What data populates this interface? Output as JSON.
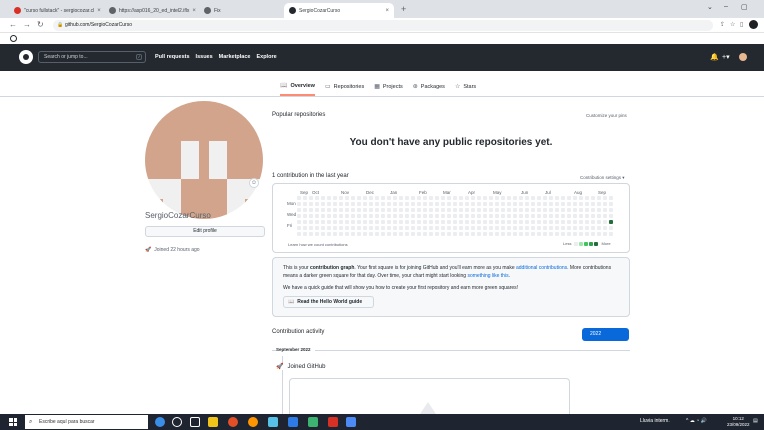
{
  "browser": {
    "tabs": [
      {
        "title": "\"curso fullstack\" - sergiocozar.cl",
        "favicon_color": "#d93025"
      },
      {
        "title": "https://asp016_20_ed_intel2.iflx",
        "favicon_color": "#5f6368"
      },
      {
        "title": "Fix",
        "favicon_color": "#5f6368"
      },
      {
        "title": "SergioCozarCurso",
        "favicon_color": "#24292f"
      }
    ],
    "new_tab": "+",
    "url": "github.com/SergioCozarCurso"
  },
  "github_header": {
    "search_placeholder": "Search or jump to...",
    "slash_key": "/",
    "nav": [
      "Pull requests",
      "Issues",
      "Marketplace",
      "Explore"
    ],
    "bell": "🔔",
    "plus": "+▾"
  },
  "profile_tabs": [
    {
      "label": "Overview",
      "icon": "📖",
      "active": true
    },
    {
      "label": "Repositories",
      "icon": "▭"
    },
    {
      "label": "Projects",
      "icon": "▦"
    },
    {
      "label": "Packages",
      "icon": "⊛"
    },
    {
      "label": "Stars",
      "icon": "☆"
    }
  ],
  "profile": {
    "username": "SergioCozarCurso",
    "edit_button": "Edit profile",
    "joined": "Joined 22 hours ago",
    "status_icon": "☺"
  },
  "popular": {
    "title": "Popular repositories",
    "customize": "Customize your pins",
    "empty": "You don't have any public repositories yet."
  },
  "contributions": {
    "title": "1 contribution in the last year",
    "settings": "Contribution settings ▾",
    "months": [
      "Sep",
      "Oct",
      "Nov",
      "Dec",
      "Jan",
      "Feb",
      "Mar",
      "Apr",
      "May",
      "Jun",
      "Jul",
      "Aug",
      "Sep"
    ],
    "days": [
      "Mon",
      "Wed",
      "Fri"
    ],
    "learn_how": "Learn how we count contributions",
    "legend_less": "Less",
    "legend_more": "More",
    "legend_colors": [
      "#ebedf0",
      "#9be9a8",
      "#40c463",
      "#30a14e",
      "#216e39"
    ],
    "weeks": 53,
    "active_cell": {
      "week": 52,
      "day": 4,
      "level": 4
    }
  },
  "explanation": {
    "p1_a": "This is your ",
    "p1_bold": "contribution graph",
    "p1_b": ". Your first square is for joining GitHub and you'll earn more as you make ",
    "p1_link": "additional contributions",
    "p1_c": ". More contributions means a darker green square for that day. Over time, your chart might start looking ",
    "p1_link2": "something like this",
    "p1_d": ".",
    "p2": "We have a quick guide that will show you how to create your first repository and earn more green squares!",
    "button": "Read the Hello World guide"
  },
  "activity": {
    "title": "Contribution activity",
    "year": "2022",
    "month": "September 2022",
    "event": "Joined GitHub"
  },
  "taskbar": {
    "search_placeholder": "Escribe aquí para buscar",
    "weather": "Lluvia interm.",
    "tray_icons": "^ ☁ ◔ 🔊",
    "time": "10:12",
    "date": "23/09/2022"
  }
}
